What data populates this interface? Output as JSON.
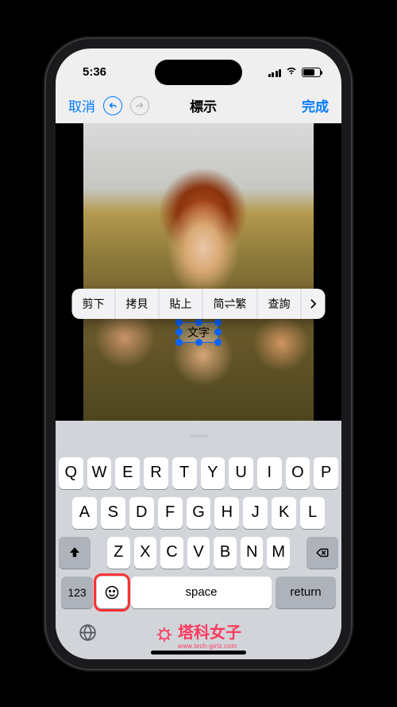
{
  "status": {
    "time": "5:36"
  },
  "nav": {
    "cancel": "取消",
    "title": "標示",
    "done": "完成"
  },
  "callout": {
    "cut": "剪下",
    "copy": "拷貝",
    "paste": "貼上",
    "convert": "简⇌繁",
    "lookup": "查詢"
  },
  "textbox": {
    "value": "文字"
  },
  "keyboard": {
    "row1": [
      "Q",
      "W",
      "E",
      "R",
      "T",
      "Y",
      "U",
      "I",
      "O",
      "P"
    ],
    "row2": [
      "A",
      "S",
      "D",
      "F",
      "G",
      "H",
      "J",
      "K",
      "L"
    ],
    "row3": [
      "Z",
      "X",
      "C",
      "V",
      "B",
      "N",
      "M"
    ],
    "numkey": "123",
    "space": "space",
    "return": "return"
  },
  "brand": {
    "cn": "塔科女子",
    "en": "www.tech-girlz.com"
  }
}
